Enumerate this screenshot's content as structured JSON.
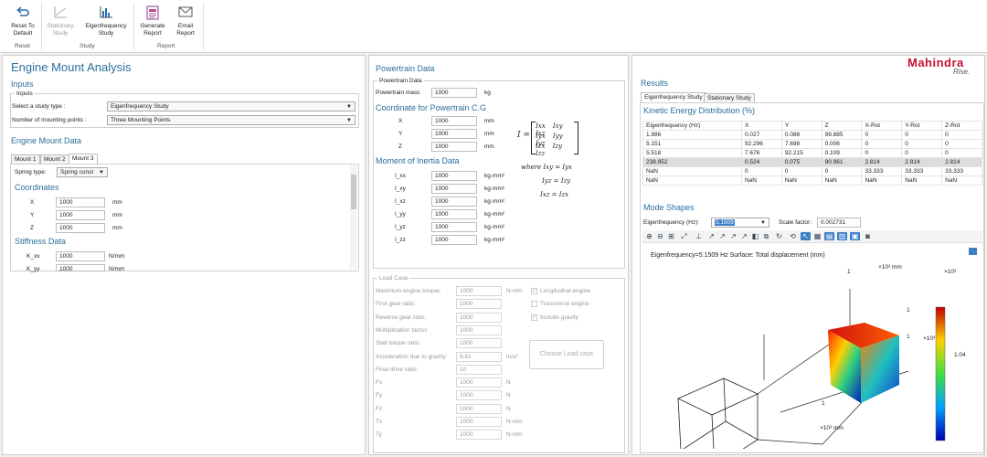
{
  "ribbon": {
    "reset": {
      "label": "Reset To\nDefault",
      "l1": "Reset To",
      "l2": "Default"
    },
    "stationary": {
      "l1": "Stationary",
      "l2": "Study"
    },
    "eigen": {
      "l1": "Eigenfrequency",
      "l2": "Study"
    },
    "generate": {
      "l1": "Generate",
      "l2": "Report"
    },
    "email": {
      "l1": "Email",
      "l2": "Report"
    },
    "groups": {
      "reset": "Reset",
      "study": "Study",
      "report": "Report"
    }
  },
  "left": {
    "title": "Engine Mount Analysis",
    "inputs_heading": "Inputs",
    "inputs_group": "Inputs",
    "study_type_label": "Select a study type :",
    "study_type_value": "Eigenfrequency Study",
    "mount_points_label": "Number of mounting points :",
    "mount_points_value": "Three Mounting Points",
    "mount_data_heading": "Engine Mount Data",
    "tabs": [
      "Mount 1",
      "Mount 2",
      "Mount 3"
    ],
    "spring_type_label": "Spring type:",
    "spring_type_value": "Spring const",
    "coordinates_heading": "Coordinates",
    "coords": [
      {
        "label": "X",
        "value": "1000",
        "unit": "mm"
      },
      {
        "label": "Y",
        "value": "1000",
        "unit": "mm"
      },
      {
        "label": "Z",
        "value": "1000",
        "unit": "mm"
      }
    ],
    "stiffness_heading": "Stiffness Data",
    "stiffness": [
      {
        "label": "K_xx",
        "value": "1000",
        "unit": "N/mm"
      },
      {
        "label": "K_yy",
        "value": "1000",
        "unit": "N/mm"
      }
    ]
  },
  "middle": {
    "title": "Powertrain Data",
    "group": "Powertrain Data",
    "mass_label": "Powertrain mass",
    "mass_value": "1000",
    "mass_unit": "kg",
    "cg_heading": "Coordinate for Powertrain C.G",
    "cg": [
      {
        "label": "X",
        "value": "1000",
        "unit": "mm"
      },
      {
        "label": "Y",
        "value": "1000",
        "unit": "mm"
      },
      {
        "label": "Z",
        "value": "1000",
        "unit": "mm"
      }
    ],
    "moi_heading": "Moment of Inertia Data",
    "moi": [
      {
        "label": "I_xx",
        "value": "1000",
        "unit": "kg·mm²"
      },
      {
        "label": "I_xy",
        "value": "1000",
        "unit": "kg·mm²"
      },
      {
        "label": "I_xz",
        "value": "1000",
        "unit": "kg·mm²"
      },
      {
        "label": "I_yy",
        "value": "1000",
        "unit": "kg·mm²"
      },
      {
        "label": "I_yz",
        "value": "1000",
        "unit": "kg·mm²"
      },
      {
        "label": "I_zz",
        "value": "1000",
        "unit": "kg·mm²"
      }
    ],
    "matrix": {
      "I": "I =",
      "r1": [
        "Ixx",
        "Ixy",
        "Ixz"
      ],
      "r2": [
        "Iyx",
        "Iyy",
        "Iyz"
      ],
      "r3": [
        "Izx",
        "Izy",
        "Izz"
      ],
      "where": "where  Ixy = Iyx",
      "eq2": "Iyz = Izy",
      "eq3": "Ixz = Izx"
    },
    "load_case": {
      "group": "Load Case",
      "rows": [
        {
          "label": "Maximum engine torque:",
          "value": "1000",
          "unit": "N·mm"
        },
        {
          "label": "First gear ratio:",
          "value": "1000",
          "unit": ""
        },
        {
          "label": "Reverse gear ratio:",
          "value": "1000",
          "unit": ""
        },
        {
          "label": "Multiplication factor:",
          "value": "1000",
          "unit": ""
        },
        {
          "label": "Stall torque ratio:",
          "value": "1000",
          "unit": ""
        },
        {
          "label": "Acceleration due to gravity:",
          "value": "9.81",
          "unit": "m/s²"
        },
        {
          "label": "Final drive ratio:",
          "value": "10",
          "unit": ""
        },
        {
          "label": "Fx",
          "value": "1000",
          "unit": "N"
        },
        {
          "label": "Fy",
          "value": "1000",
          "unit": "N"
        },
        {
          "label": "Fz",
          "value": "1000",
          "unit": "N"
        },
        {
          "label": "Tx",
          "value": "1000",
          "unit": "N·mm"
        },
        {
          "label": "Ty",
          "value": "1000",
          "unit": "N·mm"
        }
      ],
      "checks": [
        {
          "label": "Longitudnal engine",
          "checked": true
        },
        {
          "label": "Transverse engine",
          "checked": false
        },
        {
          "label": "Include gravity",
          "checked": true
        }
      ],
      "button": "Choose Load case"
    }
  },
  "right": {
    "brand": "Mahindra",
    "tagline": "Rise.",
    "title": "Results",
    "tabs": [
      "Eigenfrequency Study",
      "Stationary Study"
    ],
    "ke_heading": "Kinetic Energy Distribution (%)",
    "ke_headers": [
      "Eigenfrequency (Hz)",
      "X",
      "Y",
      "Z",
      "X-Rot",
      "Y-Rot",
      "Z-Rot"
    ],
    "ke_rows": [
      [
        "1.986",
        "0.027",
        "0.088",
        "99.885",
        "0",
        "0",
        "0"
      ],
      [
        "5.151",
        "92.296",
        "7.698",
        "0.006",
        "0",
        "0",
        "0"
      ],
      [
        "5.518",
        "7.676",
        "92.215",
        "0.109",
        "0",
        "0",
        "0"
      ],
      [
        "238.952",
        "0.524",
        "0.075",
        "90.961",
        "2.814",
        "2.814",
        "2.814"
      ],
      [
        "NaN",
        "0",
        "0",
        "0",
        "33.333",
        "33.333",
        "33.333"
      ],
      [
        "NaN",
        "NaN",
        "NaN",
        "NaN",
        "NaN",
        "NaN",
        "NaN"
      ]
    ],
    "highlight_row": 3,
    "modes_heading": "Mode Shapes",
    "eigen_label": "Eigenfrequency (Hz):",
    "eigen_value": "5.1509",
    "scale_label": "Scale factor:",
    "scale_value": "0.002731",
    "plot_title": "Eigenfrequency=5.1509 Hz     Surface: Total displacement (mm)",
    "axis_top": "×10³ mm",
    "axis_bottom": "×10³ mm",
    "axis_right": "×10³",
    "cb_exp": "×10³",
    "cb_value": "1.04",
    "axis_one": "1",
    "colors": {
      "accent": "#2b6f9e",
      "brand": "#c8102e",
      "highlight": "#3d7fc5"
    }
  }
}
